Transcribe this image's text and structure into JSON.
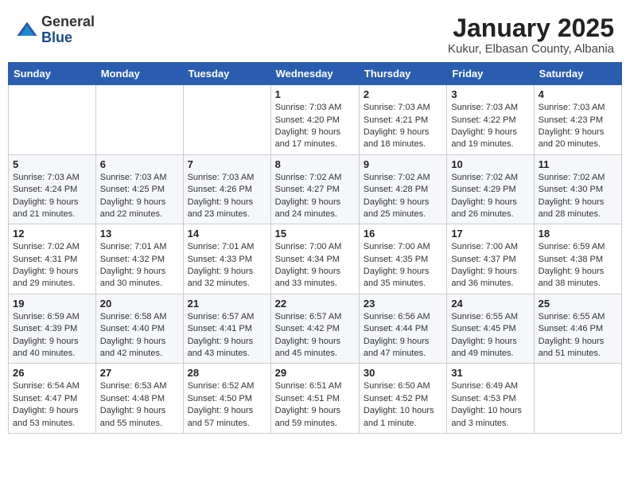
{
  "header": {
    "logo_general": "General",
    "logo_blue": "Blue",
    "month_title": "January 2025",
    "subtitle": "Kukur, Elbasan County, Albania"
  },
  "weekdays": [
    "Sunday",
    "Monday",
    "Tuesday",
    "Wednesday",
    "Thursday",
    "Friday",
    "Saturday"
  ],
  "weeks": [
    [
      {
        "day": "",
        "sunrise": "",
        "sunset": "",
        "daylight": ""
      },
      {
        "day": "",
        "sunrise": "",
        "sunset": "",
        "daylight": ""
      },
      {
        "day": "",
        "sunrise": "",
        "sunset": "",
        "daylight": ""
      },
      {
        "day": "1",
        "sunrise": "Sunrise: 7:03 AM",
        "sunset": "Sunset: 4:20 PM",
        "daylight": "Daylight: 9 hours and 17 minutes."
      },
      {
        "day": "2",
        "sunrise": "Sunrise: 7:03 AM",
        "sunset": "Sunset: 4:21 PM",
        "daylight": "Daylight: 9 hours and 18 minutes."
      },
      {
        "day": "3",
        "sunrise": "Sunrise: 7:03 AM",
        "sunset": "Sunset: 4:22 PM",
        "daylight": "Daylight: 9 hours and 19 minutes."
      },
      {
        "day": "4",
        "sunrise": "Sunrise: 7:03 AM",
        "sunset": "Sunset: 4:23 PM",
        "daylight": "Daylight: 9 hours and 20 minutes."
      }
    ],
    [
      {
        "day": "5",
        "sunrise": "Sunrise: 7:03 AM",
        "sunset": "Sunset: 4:24 PM",
        "daylight": "Daylight: 9 hours and 21 minutes."
      },
      {
        "day": "6",
        "sunrise": "Sunrise: 7:03 AM",
        "sunset": "Sunset: 4:25 PM",
        "daylight": "Daylight: 9 hours and 22 minutes."
      },
      {
        "day": "7",
        "sunrise": "Sunrise: 7:03 AM",
        "sunset": "Sunset: 4:26 PM",
        "daylight": "Daylight: 9 hours and 23 minutes."
      },
      {
        "day": "8",
        "sunrise": "Sunrise: 7:02 AM",
        "sunset": "Sunset: 4:27 PM",
        "daylight": "Daylight: 9 hours and 24 minutes."
      },
      {
        "day": "9",
        "sunrise": "Sunrise: 7:02 AM",
        "sunset": "Sunset: 4:28 PM",
        "daylight": "Daylight: 9 hours and 25 minutes."
      },
      {
        "day": "10",
        "sunrise": "Sunrise: 7:02 AM",
        "sunset": "Sunset: 4:29 PM",
        "daylight": "Daylight: 9 hours and 26 minutes."
      },
      {
        "day": "11",
        "sunrise": "Sunrise: 7:02 AM",
        "sunset": "Sunset: 4:30 PM",
        "daylight": "Daylight: 9 hours and 28 minutes."
      }
    ],
    [
      {
        "day": "12",
        "sunrise": "Sunrise: 7:02 AM",
        "sunset": "Sunset: 4:31 PM",
        "daylight": "Daylight: 9 hours and 29 minutes."
      },
      {
        "day": "13",
        "sunrise": "Sunrise: 7:01 AM",
        "sunset": "Sunset: 4:32 PM",
        "daylight": "Daylight: 9 hours and 30 minutes."
      },
      {
        "day": "14",
        "sunrise": "Sunrise: 7:01 AM",
        "sunset": "Sunset: 4:33 PM",
        "daylight": "Daylight: 9 hours and 32 minutes."
      },
      {
        "day": "15",
        "sunrise": "Sunrise: 7:00 AM",
        "sunset": "Sunset: 4:34 PM",
        "daylight": "Daylight: 9 hours and 33 minutes."
      },
      {
        "day": "16",
        "sunrise": "Sunrise: 7:00 AM",
        "sunset": "Sunset: 4:35 PM",
        "daylight": "Daylight: 9 hours and 35 minutes."
      },
      {
        "day": "17",
        "sunrise": "Sunrise: 7:00 AM",
        "sunset": "Sunset: 4:37 PM",
        "daylight": "Daylight: 9 hours and 36 minutes."
      },
      {
        "day": "18",
        "sunrise": "Sunrise: 6:59 AM",
        "sunset": "Sunset: 4:38 PM",
        "daylight": "Daylight: 9 hours and 38 minutes."
      }
    ],
    [
      {
        "day": "19",
        "sunrise": "Sunrise: 6:59 AM",
        "sunset": "Sunset: 4:39 PM",
        "daylight": "Daylight: 9 hours and 40 minutes."
      },
      {
        "day": "20",
        "sunrise": "Sunrise: 6:58 AM",
        "sunset": "Sunset: 4:40 PM",
        "daylight": "Daylight: 9 hours and 42 minutes."
      },
      {
        "day": "21",
        "sunrise": "Sunrise: 6:57 AM",
        "sunset": "Sunset: 4:41 PM",
        "daylight": "Daylight: 9 hours and 43 minutes."
      },
      {
        "day": "22",
        "sunrise": "Sunrise: 6:57 AM",
        "sunset": "Sunset: 4:42 PM",
        "daylight": "Daylight: 9 hours and 45 minutes."
      },
      {
        "day": "23",
        "sunrise": "Sunrise: 6:56 AM",
        "sunset": "Sunset: 4:44 PM",
        "daylight": "Daylight: 9 hours and 47 minutes."
      },
      {
        "day": "24",
        "sunrise": "Sunrise: 6:55 AM",
        "sunset": "Sunset: 4:45 PM",
        "daylight": "Daylight: 9 hours and 49 minutes."
      },
      {
        "day": "25",
        "sunrise": "Sunrise: 6:55 AM",
        "sunset": "Sunset: 4:46 PM",
        "daylight": "Daylight: 9 hours and 51 minutes."
      }
    ],
    [
      {
        "day": "26",
        "sunrise": "Sunrise: 6:54 AM",
        "sunset": "Sunset: 4:47 PM",
        "daylight": "Daylight: 9 hours and 53 minutes."
      },
      {
        "day": "27",
        "sunrise": "Sunrise: 6:53 AM",
        "sunset": "Sunset: 4:48 PM",
        "daylight": "Daylight: 9 hours and 55 minutes."
      },
      {
        "day": "28",
        "sunrise": "Sunrise: 6:52 AM",
        "sunset": "Sunset: 4:50 PM",
        "daylight": "Daylight: 9 hours and 57 minutes."
      },
      {
        "day": "29",
        "sunrise": "Sunrise: 6:51 AM",
        "sunset": "Sunset: 4:51 PM",
        "daylight": "Daylight: 9 hours and 59 minutes."
      },
      {
        "day": "30",
        "sunrise": "Sunrise: 6:50 AM",
        "sunset": "Sunset: 4:52 PM",
        "daylight": "Daylight: 10 hours and 1 minute."
      },
      {
        "day": "31",
        "sunrise": "Sunrise: 6:49 AM",
        "sunset": "Sunset: 4:53 PM",
        "daylight": "Daylight: 10 hours and 3 minutes."
      },
      {
        "day": "",
        "sunrise": "",
        "sunset": "",
        "daylight": ""
      }
    ]
  ]
}
